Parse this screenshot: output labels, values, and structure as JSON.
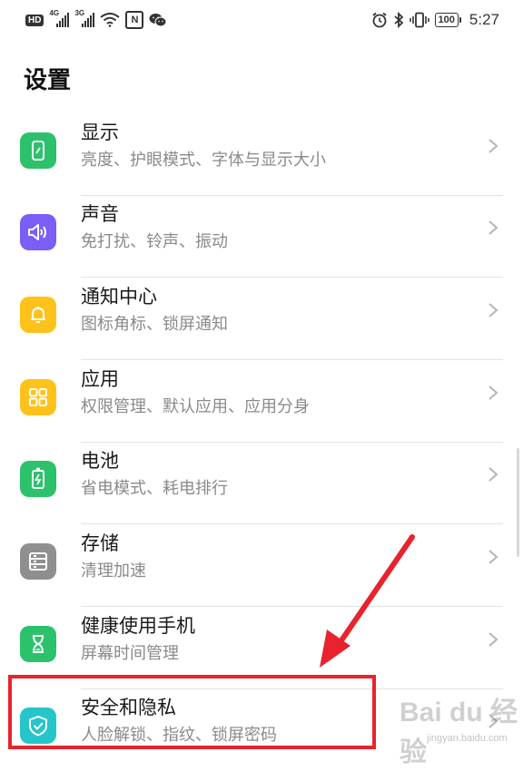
{
  "status_bar": {
    "hd_badge": "HD",
    "network_1": "4G",
    "network_2": "3G",
    "nfc_label": "N",
    "battery_level": "100",
    "time": "5:27",
    "icons": [
      "signal-icon",
      "wifi-icon",
      "nfc-icon",
      "wechat-icon",
      "alarm-icon",
      "bluetooth-icon",
      "vibrate-icon",
      "battery-icon"
    ]
  },
  "header": {
    "title": "设置"
  },
  "settings": [
    {
      "id": "display",
      "title": "显示",
      "subtitle": "亮度、护眼模式、字体与显示大小",
      "icon": "display-icon",
      "color": "#2bc26b"
    },
    {
      "id": "sound",
      "title": "声音",
      "subtitle": "免打扰、铃声、振动",
      "icon": "speaker-icon",
      "color": "#7b5ef5"
    },
    {
      "id": "notifications",
      "title": "通知中心",
      "subtitle": "图标角标、锁屏通知",
      "icon": "bell-icon",
      "color": "#ffc21a"
    },
    {
      "id": "apps",
      "title": "应用",
      "subtitle": "权限管理、默认应用、应用分身",
      "icon": "apps-grid-icon",
      "color": "#ffc21a"
    },
    {
      "id": "battery",
      "title": "电池",
      "subtitle": "省电模式、耗电排行",
      "icon": "battery-icon",
      "color": "#2bc26b"
    },
    {
      "id": "storage",
      "title": "存储",
      "subtitle": "清理加速",
      "icon": "storage-icon",
      "color": "#8f8f8f"
    },
    {
      "id": "digital_balance",
      "title": "健康使用手机",
      "subtitle": "屏幕时间管理",
      "icon": "hourglass-icon",
      "color": "#2bc26b"
    },
    {
      "id": "security",
      "title": "安全和隐私",
      "subtitle": "人脸解锁、指纹、锁屏密码",
      "icon": "shield-icon",
      "color": "#26c5c9"
    }
  ],
  "annotation": {
    "highlight_color": "#e8232d"
  },
  "watermark": {
    "brand": "Bai du 经验",
    "url": "jingyan.baidu.com"
  }
}
